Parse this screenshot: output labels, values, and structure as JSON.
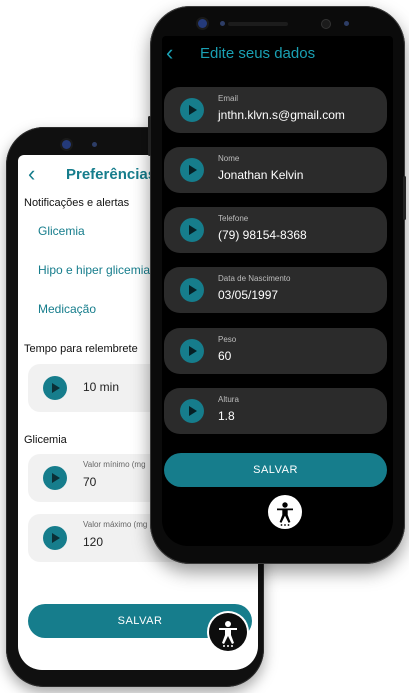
{
  "preferences_screen": {
    "back_icon": "chevron-left-icon",
    "title": "Preferências",
    "notifications_section": "Notificações e alertas",
    "menu_items": [
      {
        "label": "Glicemia"
      },
      {
        "label": "Hipo e hiper glicemia"
      },
      {
        "label": "Medicação"
      }
    ],
    "reminder_section": "Tempo para relembrete",
    "reminder_value": "10 min",
    "glycemia_section": "Glicemia",
    "glycemia_fields": [
      {
        "label": "Valor mínimo (mg",
        "value": "70"
      },
      {
        "label": "Valor máximo (mg",
        "value": "120"
      }
    ],
    "save_label": "SALVAR",
    "accessibility_icon": "accessibility-icon"
  },
  "edit_screen": {
    "back_icon": "chevron-left-icon",
    "title": "Edite seus dados",
    "fields": [
      {
        "label": "Email",
        "value": "jnthn.klvn.s@gmail.com"
      },
      {
        "label": "Nome",
        "value": "Jonathan Kelvin"
      },
      {
        "label": "Telefone",
        "value": "(79) 98154-8368"
      },
      {
        "label": "Data de Nascimento",
        "value": "03/05/1997"
      },
      {
        "label": "Peso",
        "value": "60"
      },
      {
        "label": "Altura",
        "value": "1.8"
      }
    ],
    "save_label": "SALVAR",
    "accessibility_icon": "accessibility-icon"
  },
  "colors": {
    "accent": "#167d8c",
    "accent_light": "#1aa0b3",
    "dark_card": "#2b2b2b",
    "light_card": "#f1f1f1"
  }
}
